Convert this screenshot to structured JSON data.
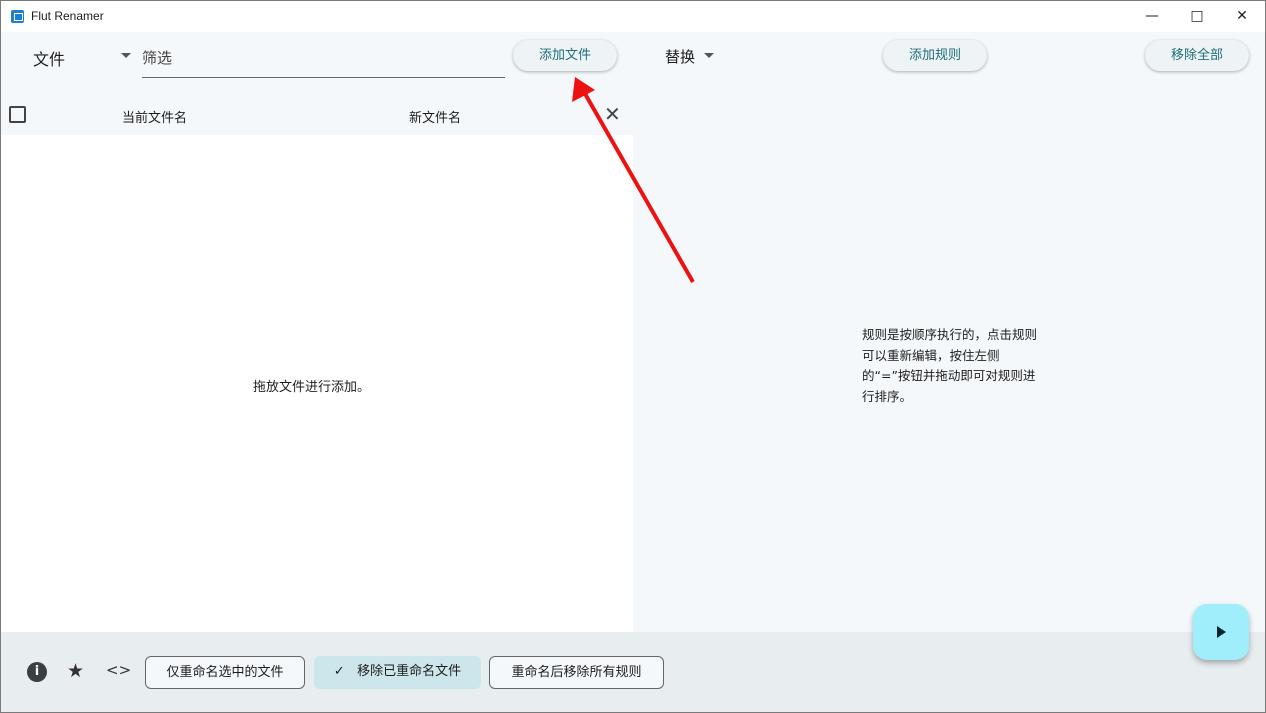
{
  "window": {
    "title": "Flut Renamer"
  },
  "toolbar": {
    "files_label": "文件",
    "filter_placeholder": "筛选",
    "add_files": "添加文件",
    "rule_type": "替换",
    "add_rule": "添加规则",
    "remove_all": "移除全部"
  },
  "file_list": {
    "col_current": "当前文件名",
    "col_new": "新文件名",
    "empty_hint": "拖放文件进行添加。"
  },
  "rules": {
    "empty_hint": "规则是按顺序执行的，点击规则可以重新编辑，按住左侧的“=”按钮并拖动即可对规则进行排序。"
  },
  "bottom": {
    "rename_selected_only": "仅重命名选中的文件",
    "remove_renamed": "移除已重命名文件",
    "remove_renamed_checked": true,
    "remove_rules_after": "重命名后移除所有规则"
  },
  "colors": {
    "accent": "#1f6d78",
    "fab": "#a0eefc",
    "annotation_arrow": "#ee1111"
  }
}
